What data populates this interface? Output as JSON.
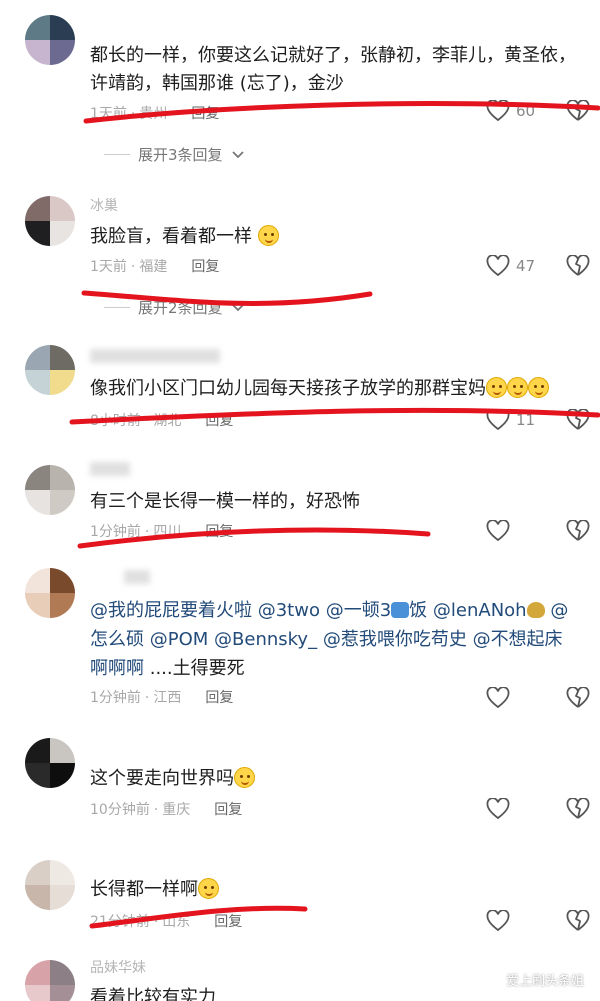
{
  "comments": [
    {
      "text": "都长的一样，你要这么记就好了，张静初，李菲儿，黄圣依，许靖韵，韩国那谁 (忘了)，金沙",
      "time": "1天前",
      "location": "贵州",
      "reply": "回复",
      "likes": "60",
      "expand": "展开3条回复"
    },
    {
      "name": "冰巢",
      "text": "我脸盲，看着都一样",
      "time": "1天前",
      "location": "福建",
      "reply": "回复",
      "likes": "47",
      "expand": "展开2条回复"
    },
    {
      "text": "像我们小区门口幼儿园每天接孩子放学的那群宝妈",
      "time": "8小时前",
      "location": "湖北",
      "reply": "回复",
      "likes": "11"
    },
    {
      "text": "有三个是长得一模一样的，好恐怖",
      "time": "1分钟前",
      "location": "四川",
      "reply": "回复"
    },
    {
      "text_parts": [
        "@我的屁屁要着火啦",
        "@3two",
        "@一顿3",
        "饭",
        "@lenANoh",
        "@怎么硕",
        "@POM",
        "@Bennsky_",
        "@惹我喂你吃苟史",
        "@不想起床啊啊啊",
        "....土得要死"
      ],
      "time": "1分钟前",
      "location": "江西",
      "reply": "回复"
    },
    {
      "text": "这个要走向世界吗",
      "time": "10分钟前",
      "location": "重庆",
      "reply": "回复"
    },
    {
      "text": "长得都一样啊",
      "time": "21分钟前",
      "location": "山东",
      "reply": "回复"
    },
    {
      "name": "品妹华妹",
      "text": "看着比较有实力"
    }
  ],
  "watermark": "爱上刷头条姐",
  "colors": {
    "annotation": "#e4141e",
    "mention": "#234b7a",
    "meta": "#a8a8a8"
  }
}
